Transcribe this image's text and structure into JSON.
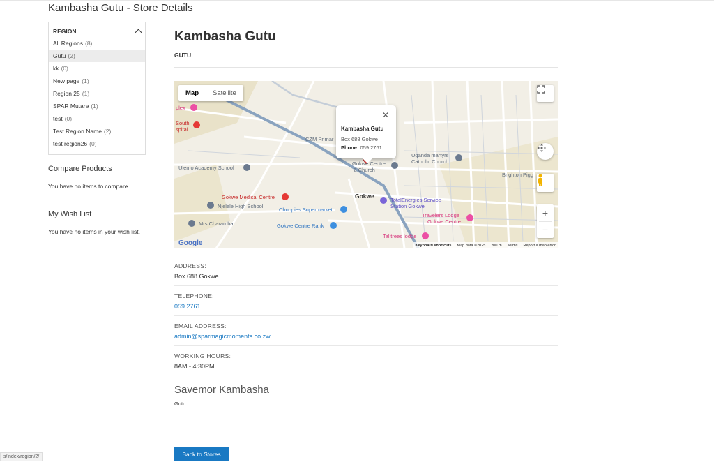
{
  "page": {
    "title": "Kambasha Gutu - Store Details"
  },
  "sidebar": {
    "region_heading": "REGION",
    "regions": [
      {
        "label": "All Regions",
        "count": "(8)"
      },
      {
        "label": "Gutu",
        "count": "(2)"
      },
      {
        "label": "kk",
        "count": "(0)"
      },
      {
        "label": "New page",
        "count": "(1)"
      },
      {
        "label": "Region 25",
        "count": "(1)"
      },
      {
        "label": "SPAR Mutare",
        "count": "(1)"
      },
      {
        "label": "test",
        "count": "(0)"
      },
      {
        "label": "Test Region Name",
        "count": "(2)"
      },
      {
        "label": "test region26",
        "count": "(0)"
      }
    ],
    "compare_heading": "Compare Products",
    "compare_text": "You have no items to compare.",
    "wishlist_heading": "My Wish List",
    "wishlist_text": "You have no items in your wish list."
  },
  "store": {
    "name": "Kambasha Gutu",
    "region": "GUTU"
  },
  "map": {
    "type_map": "Map",
    "type_satellite": "Satellite",
    "popup": {
      "title": "Kambasha Gutu",
      "address": "Box 688 Gokwe",
      "phone_label": "Phone:",
      "phone": "059 2761"
    },
    "labels": {
      "plex": "plex",
      "south_hospital_1": "South",
      "south_hospital_2": "spital",
      "czm": "CZM Primar",
      "ulemo": "Ulemo Academy School",
      "gokwe_centre_church_1": "Gokwe Centre",
      "gokwe_centre_church_2": "Z  Church",
      "uganda_1": "Uganda martyrs",
      "uganda_2": "Catholic Church",
      "brighton": "Brighton Pigg",
      "medical": "Gokwe Medical Centre",
      "njelele": "Njelele High School",
      "choppies": "Choppies Supermarket",
      "gokwe": "Gokwe",
      "total_1": "TotalEnergies Service",
      "total_2": "Station Gokwe",
      "travelers_1": "Travelers Lodge",
      "travelers_2": "Gokwe Centre",
      "charamba": "Mrs Charamba",
      "rank": "Gokwe Centre Rank",
      "talltrees": "Talltrees lodge"
    },
    "google": "Google",
    "attribution": {
      "shortcuts": "Keyboard shortcuts",
      "mapdata": "Map data ©2025",
      "scale": "200 m",
      "terms": "Terms",
      "report": "Report a map error"
    },
    "zoom_in": "+",
    "zoom_out": "−"
  },
  "details": {
    "address_label": "ADDRESS:",
    "address": "Box 688 Gokwe",
    "telephone_label": "TELEPHONE:",
    "telephone": "059 2761",
    "email_label": "EMAIL ADDRESS:",
    "email": "admin@sparmagicmoments.co.zw",
    "hours_label": "WORKING HOURS:",
    "hours": "8AM - 4:30PM"
  },
  "other_store": {
    "name": "Savemor Kambasha",
    "region": "Gutu"
  },
  "back_button": "Back to Stores",
  "status_url": "s/index/region/2/",
  "colors": {
    "accent": "#1979c3",
    "pin": "#e53935",
    "road": "#8aa3bf"
  }
}
